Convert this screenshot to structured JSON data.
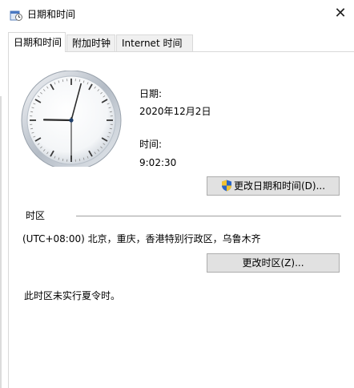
{
  "window": {
    "title": "日期和时间",
    "close_glyph": "✕"
  },
  "tabs": [
    {
      "label": "日期和时间",
      "active": true
    },
    {
      "label": "附加时钟",
      "active": false
    },
    {
      "label": "Internet 时间",
      "active": false
    }
  ],
  "datetime": {
    "date_label": "日期:",
    "date_value": "2020年12月2日",
    "time_label": "时间:",
    "time_value": "9:02:30",
    "change_button": "更改日期和时间(D)..."
  },
  "timezone": {
    "section_label": "时区",
    "value": "(UTC+08:00) 北京，重庆，香港特别行政区，乌鲁木齐",
    "change_button": "更改时区(Z)...",
    "dst_note": "此时区未实行夏令时。"
  },
  "clock": {
    "hours": 9,
    "minutes": 2,
    "seconds": 30
  },
  "colors": {
    "accent": "#1f5fb0",
    "shield_blue": "#2a64c5",
    "shield_yellow": "#f1c232"
  },
  "icons": {
    "title": "date-time-icon",
    "shield": "uac-shield-icon",
    "close": "close-icon"
  }
}
